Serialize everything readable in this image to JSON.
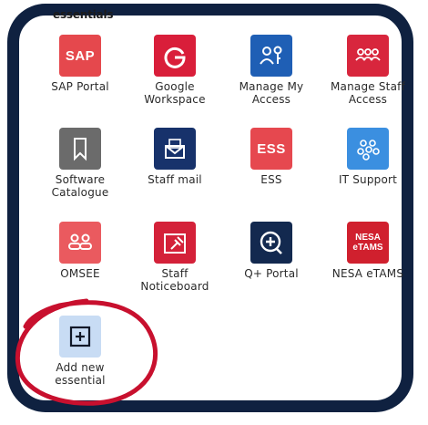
{
  "section": {
    "title": "essentials"
  },
  "tiles": [
    {
      "label": "SAP Portal",
      "icon": "sap-logo-icon",
      "icon_text": "SAP",
      "color": "#e5484d"
    },
    {
      "label": "Google\nWorkspace",
      "icon": "google-g-icon",
      "color": "#d91e3a"
    },
    {
      "label": "Manage My\nAccess",
      "icon": "user-key-icon",
      "color": "#1f5fb5"
    },
    {
      "label": "Manage Staff\nAccess",
      "icon": "users-group-icon",
      "color": "#d8263d"
    },
    {
      "label": "Software\nCatalogue",
      "icon": "bookmark-icon",
      "color": "#6b6b6b"
    },
    {
      "label": "Staff mail",
      "icon": "mail-envelope-icon",
      "color": "#17326b"
    },
    {
      "label": "ESS",
      "icon": "ess-logo-icon",
      "icon_text": "ESS",
      "color": "#e6484f"
    },
    {
      "label": "IT Support",
      "icon": "network-nodes-icon",
      "color": "#3b8fe0"
    },
    {
      "label": "OMSEE",
      "icon": "people-pair-icon",
      "color": "#ea5a5f"
    },
    {
      "label": "Staff\nNoticeboard",
      "icon": "noticeboard-pin-icon",
      "color": "#d42139"
    },
    {
      "label": "Q+ Portal",
      "icon": "q-plus-icon",
      "color": "#13294f"
    },
    {
      "label": "NESA eTAMS",
      "icon": "nesa-etams-icon",
      "icon_text": "NESA\neTAMS",
      "color": "#d0202e"
    }
  ],
  "add_tile": {
    "label": "Add new\nessential",
    "icon": "add-square-icon",
    "color": "#c8dcf4"
  },
  "annotation": {
    "color": "#c8102e"
  },
  "frame": {
    "color": "#0f2140"
  }
}
